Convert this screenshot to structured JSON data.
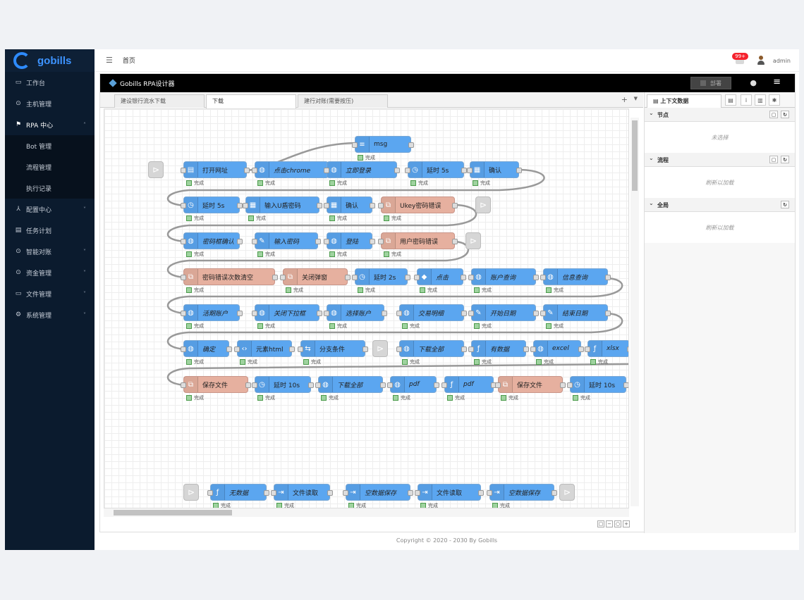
{
  "app": {
    "logo": "gobills"
  },
  "sidebar": {
    "items": [
      {
        "icon": "monitor-icon",
        "label": "工作台"
      },
      {
        "icon": "server-icon",
        "label": "主机管理"
      },
      {
        "icon": "flag-icon",
        "label": "RPA 中心",
        "open": true,
        "children": [
          {
            "label": "Bot 管理"
          },
          {
            "label": "流程管理"
          },
          {
            "label": "执行记录"
          }
        ]
      },
      {
        "icon": "config-icon",
        "label": "配置中心"
      },
      {
        "icon": "calendar-icon",
        "label": "任务计划"
      },
      {
        "icon": "reconcile-icon",
        "label": "智能对账"
      },
      {
        "icon": "fund-icon",
        "label": "资金管理"
      },
      {
        "icon": "file-icon",
        "label": "文件管理"
      },
      {
        "icon": "gear-icon",
        "label": "系统管理"
      }
    ]
  },
  "topbar": {
    "breadcrumb": "首页",
    "badge": "99+",
    "user": "admin"
  },
  "designer": {
    "title": "Gobills RPA设计器",
    "deploy": "部署",
    "tabs": [
      "建设银行流水下载",
      "下载",
      "建行对账(需要按压)"
    ],
    "status_done": "完成"
  },
  "flow": {
    "row0": [
      "msg"
    ],
    "row1": [
      "打开网址",
      "点击chrome",
      "立即登录",
      "延时 5s",
      "确认"
    ],
    "row2": [
      "延时 5s",
      "输入U盾密码",
      "确认",
      "Ukey密码错误"
    ],
    "row3": [
      "密码框确认",
      "输入密码",
      "登陆",
      "用户密码错误"
    ],
    "row4": [
      "密码错误次数清空",
      "关闭弹窗",
      "延时 2s",
      "点击",
      "账户查询",
      "信息查询"
    ],
    "row5": [
      "活期账户",
      "关闭下拉框",
      "选择账户",
      "交易明细",
      "开始日期",
      "结束日期"
    ],
    "row6": [
      "确定",
      "元素html",
      "分支条件",
      "下载全部",
      "有数据",
      "excel",
      "xlsx"
    ],
    "row7": [
      "保存文件",
      "延时 10s",
      "下载全部",
      "pdf",
      "pdf",
      "保存文件",
      "延时 10s"
    ],
    "row8": [
      "无数据",
      "文件读取",
      "空数据保存",
      "文件读取",
      "空数据保存"
    ]
  },
  "panel": {
    "tab": "上下文数据",
    "sections": [
      {
        "title": "节点",
        "body": "未选择"
      },
      {
        "title": "流程",
        "body": "刷新以加载"
      },
      {
        "title": "全局",
        "body": "刷新以加载"
      }
    ]
  },
  "footer": "Copyright © 2020 - 2030 By Gobills",
  "colors": {
    "sidebar": "#0b1b2e",
    "node": "#5ba6f0",
    "node_error": "#e6b09f",
    "brand": "#3d93ff"
  }
}
